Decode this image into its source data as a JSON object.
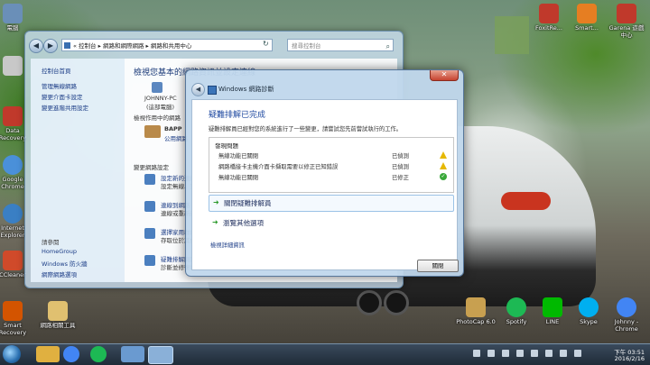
{
  "desktop": {
    "left_icons": [
      {
        "label": "電腦",
        "color": "#6a8fb8"
      },
      {
        "label": "",
        "color": "#c8c8c8"
      },
      {
        "label": "",
        "color": "#b23a2a"
      },
      {
        "label": "Data Recovery",
        "color": "#c0392b"
      },
      {
        "label": "Google Chrome",
        "color": "#4a90d9"
      },
      {
        "label": "Internet Explorer",
        "color": "#3a7fc4"
      },
      {
        "label": "CCleaner",
        "color": "#d04a2a"
      },
      {
        "label": "Smart Recovery",
        "color": "#d35400"
      },
      {
        "label": "網路相關工具",
        "color": "#e0c070"
      }
    ],
    "right_icons": [
      {
        "label": "FoxitRe...",
        "color": "#c0392b"
      },
      {
        "label": "Smart...",
        "color": "#e67e22"
      },
      {
        "label": "Garena 遊戲中心",
        "color": "#c0392b"
      },
      {
        "label": "PhotoCap 6.0",
        "color": "#c8a050"
      },
      {
        "label": "Spotify",
        "color": "#1db954"
      },
      {
        "label": "LINE",
        "color": "#00b900"
      },
      {
        "label": "Skype",
        "color": "#00aff0"
      },
      {
        "label": "Johnny - Chrome",
        "color": "#4285f4"
      }
    ]
  },
  "explorer": {
    "address": "« 控制台 ▸ 網路和網際網路 ▸ 網路和共用中心",
    "search_placeholder": "搜尋控制台",
    "sidebar": {
      "top_links": [
        "控制台首頁",
        "管理無線網路",
        "變更介面卡設定",
        "變更進階共用設定"
      ],
      "see_also_title": "請參閱",
      "see_also_links": [
        "HomeGroup",
        "Windows 防火牆",
        "網際網路選項"
      ]
    },
    "main": {
      "title": "檢視您基本的網路資訊並設定連線",
      "computer_name": "JOHNNY-PC",
      "computer_sub": "(這部電腦)",
      "active_networks_title": "檢視作用中的網路",
      "network_name": "BAPP",
      "network_type": "公用網路",
      "change_settings_title": "變更網路設定",
      "settings": [
        {
          "link": "設定新的連線",
          "desc": "設定無線、寬頻"
        },
        {
          "link": "連線到網路",
          "desc": "連線或重新連線"
        },
        {
          "link": "選擇家用群組",
          "desc": "存取位於其他網"
        },
        {
          "link": "疑難排解問題",
          "desc": "診斷並修復網路"
        }
      ]
    }
  },
  "dialog": {
    "title": "Windows 網路診斷",
    "close_label": "✕",
    "heading": "疑難排解已完成",
    "description": "疑難排解員已經對您的系統進行了一些變更，請嘗試您先前嘗試執行的工作。",
    "issues_header": "發現問題",
    "issues": [
      {
        "name": "無線功能已關閉",
        "status": "已偵測",
        "icon": "warning-icon"
      },
      {
        "name": "網路橋接卡主機介面卡擷取需要以修正已知錯誤",
        "status": "已偵測",
        "icon": "warning-icon"
      },
      {
        "name": "無線功能已關閉",
        "status": "已修正",
        "icon": "check-icon"
      }
    ],
    "action_close": "關閉疑難排解員",
    "action_browse": "瀏覽其他選項",
    "details_link": "檢視詳細資訊",
    "close_button": "關閉"
  },
  "taskbar": {
    "apps": [
      {
        "name": "folder",
        "color": "#e0b040"
      },
      {
        "name": "chrome",
        "color": "#4285f4"
      },
      {
        "name": "spotify",
        "color": "#1db954"
      },
      {
        "name": "control-panel",
        "color": "#6a9ad0"
      },
      {
        "name": "network-diagnostics",
        "color": "#8ab0d8"
      }
    ],
    "time": "下午 03:51",
    "date": "2016/2/16"
  }
}
